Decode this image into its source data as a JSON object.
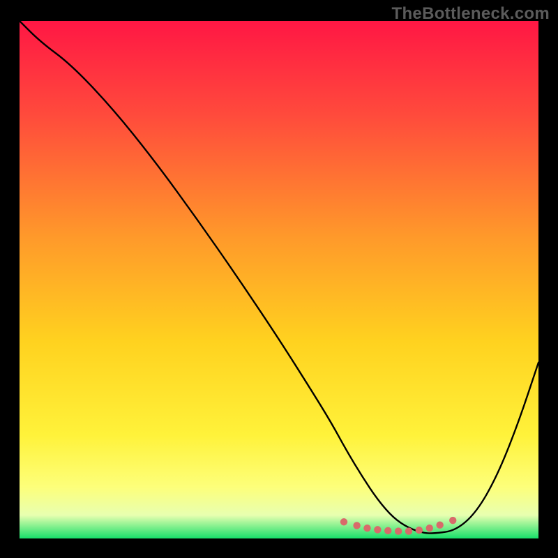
{
  "watermark": "TheBottleneck.com",
  "chart_data": {
    "type": "line",
    "title": "",
    "xlabel": "",
    "ylabel": "",
    "xlim": [
      0,
      100
    ],
    "ylim": [
      0,
      100
    ],
    "grid": false,
    "legend": false,
    "series": [
      {
        "name": "bottleneck-curve",
        "color": "#000000",
        "x": [
          0,
          4,
          10,
          18,
          26,
          34,
          42,
          50,
          56,
          60,
          63,
          66,
          69,
          72,
          75,
          78,
          80,
          84,
          88,
          92,
          96,
          100
        ],
        "y": [
          100,
          96,
          91.5,
          83,
          73,
          62,
          50.5,
          38.5,
          29,
          22.5,
          17,
          12,
          7.5,
          4,
          2,
          1,
          1,
          1.5,
          5,
          12,
          22,
          34
        ]
      },
      {
        "name": "optimal-markers",
        "color": "#d86a6a",
        "marker": "circle",
        "x": [
          62.5,
          65,
          67,
          69,
          71,
          73,
          75,
          77,
          79,
          81,
          83.5
        ],
        "y": [
          3.2,
          2.5,
          2,
          1.7,
          1.5,
          1.4,
          1.4,
          1.6,
          2,
          2.6,
          3.5
        ]
      }
    ],
    "background_gradient": {
      "stops": [
        {
          "offset": 0.0,
          "color": "#ff1744"
        },
        {
          "offset": 0.18,
          "color": "#ff4a3c"
        },
        {
          "offset": 0.42,
          "color": "#ff9a2a"
        },
        {
          "offset": 0.62,
          "color": "#ffd21f"
        },
        {
          "offset": 0.8,
          "color": "#fff23a"
        },
        {
          "offset": 0.9,
          "color": "#fdff7a"
        },
        {
          "offset": 0.955,
          "color": "#e8ffb0"
        },
        {
          "offset": 1.0,
          "color": "#17e06a"
        }
      ]
    }
  }
}
